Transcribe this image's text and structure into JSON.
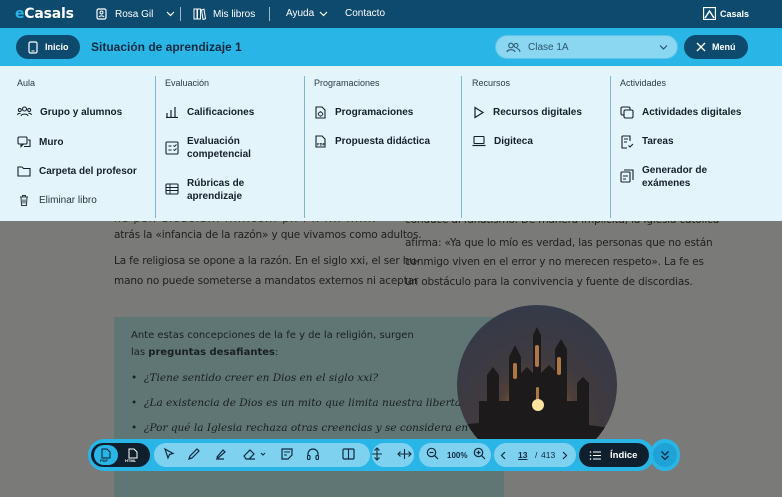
{
  "topbar": {
    "logo_prefix": "e",
    "logo_rest": "Casals",
    "user": "Rosa Gil",
    "books": "Mis libros",
    "help": "Ayuda",
    "contact": "Contacto",
    "brand": "Casals"
  },
  "header": {
    "home_label": "Inicio",
    "title": "Situación de aprendizaje 1",
    "class_value": "Clase 1A",
    "menu_label": "Menú"
  },
  "menu": {
    "columns": [
      {
        "heading": "Aula",
        "items": [
          {
            "label": "Grupo y alumnos",
            "icon": "group-icon"
          },
          {
            "label": "Muro",
            "icon": "wall-icon"
          },
          {
            "label": "Carpeta del profesor",
            "icon": "folder-icon"
          },
          {
            "label": "Eliminar libro",
            "icon": "trash-icon"
          }
        ]
      },
      {
        "heading": "Evaluación",
        "items": [
          {
            "label": "Calificaciones",
            "icon": "bar-chart-icon"
          },
          {
            "label": "Evaluación competencial",
            "icon": "assessment-icon"
          },
          {
            "label": "Rúbricas de aprendizaje",
            "icon": "rubric-icon"
          }
        ]
      },
      {
        "heading": "Programaciones",
        "items": [
          {
            "label": "Programaciones",
            "icon": "programming-icon"
          },
          {
            "label": "Propuesta didáctica",
            "icon": "pdf-document-icon"
          }
        ]
      },
      {
        "heading": "Recursos",
        "items": [
          {
            "label": "Recursos digitales",
            "icon": "play-icon"
          },
          {
            "label": "Digiteca",
            "icon": "laptop-icon"
          }
        ]
      },
      {
        "heading": "Actividades",
        "items": [
          {
            "label": "Actividades digitales",
            "icon": "digital-activities-icon"
          },
          {
            "label": "Tareas",
            "icon": "tasks-icon"
          },
          {
            "label": "Generador de exámenes",
            "icon": "exam-generator-icon"
          }
        ]
      }
    ]
  },
  "document": {
    "left_top_partial": "ne pe.. a.ouo.a... ......co... p.. . .. .... .......",
    "left_lines": [
      "atrás la «infancia de la razón» y que vivamos como adultos.",
      "La fe religiosa se opone a la razón. En el siglo xxi, el ser hu-",
      "mano no puede someterse a mandatos externos ni aceptar"
    ],
    "right_top_partial": "conduce al fanatismo. De manera implícita, la Iglesia católica",
    "right_lines": [
      "afirma: «Ya que lo mío es verdad, las personas que no están",
      "conmigo viven en el error y no merecen respeto». La fe es",
      "un obstáculo para la convivencia y fuente de discordias."
    ],
    "box_intro_1": "Ante estas concepciones de la fe y de la religión, surgen",
    "box_intro_2a": "las ",
    "box_intro_2b": "preguntas desafiantes",
    "box_intro_2c": ":",
    "questions": [
      "¿Tiene sentido creer en Dios en el siglo xxi?",
      "¿La existencia de Dios es un mito que limita nuestra libertad?",
      "¿Por qué la Iglesia rechaza otras creencias y se considera en"
    ]
  },
  "toolbar": {
    "format_pdf": "PDF",
    "format_html": "HTML",
    "zoom": "100%",
    "page_current": "13",
    "page_separator": "/",
    "page_total": "413",
    "index_label": "Índice"
  }
}
